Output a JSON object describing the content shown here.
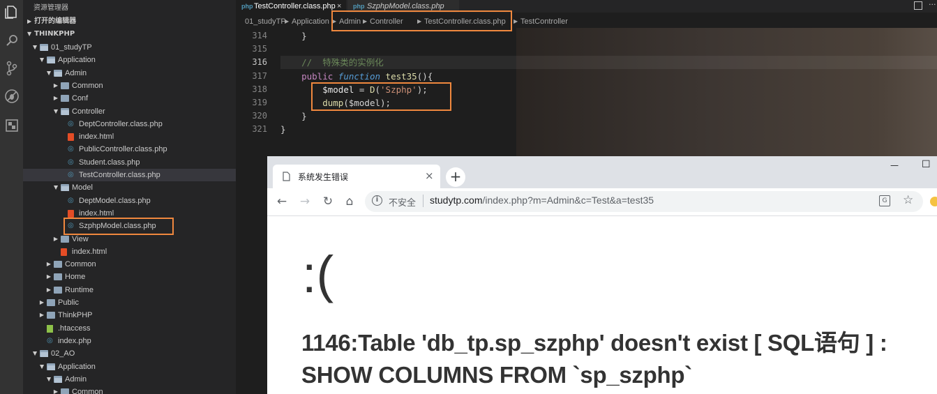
{
  "sidebar": {
    "title": "资源管理器",
    "open_editors": "打开的编辑器",
    "workspace": "THINKPHP",
    "tree": [
      {
        "label": "01_studyTP",
        "kind": "folder-open",
        "depth": 1
      },
      {
        "label": "Application",
        "kind": "folder-open",
        "depth": 2
      },
      {
        "label": "Admin",
        "kind": "folder-open",
        "depth": 3
      },
      {
        "label": "Common",
        "kind": "folder",
        "depth": 4
      },
      {
        "label": "Conf",
        "kind": "folder",
        "depth": 4
      },
      {
        "label": "Controller",
        "kind": "folder-open",
        "depth": 4
      },
      {
        "label": "DeptController.class.php",
        "kind": "php",
        "depth": 5
      },
      {
        "label": "index.html",
        "kind": "html",
        "depth": 5
      },
      {
        "label": "PublicController.class.php",
        "kind": "php",
        "depth": 5
      },
      {
        "label": "Student.class.php",
        "kind": "php",
        "depth": 5
      },
      {
        "label": "TestController.class.php",
        "kind": "php",
        "depth": 5
      },
      {
        "label": "Model",
        "kind": "folder-open",
        "depth": 4
      },
      {
        "label": "DeptModel.class.php",
        "kind": "php",
        "depth": 5
      },
      {
        "label": "index.html",
        "kind": "html",
        "depth": 5
      },
      {
        "label": "SzphpModel.class.php",
        "kind": "php",
        "depth": 5
      },
      {
        "label": "View",
        "kind": "folder",
        "depth": 4
      },
      {
        "label": "index.html",
        "kind": "html",
        "depth": 4
      },
      {
        "label": "Common",
        "kind": "folder",
        "depth": 3
      },
      {
        "label": "Home",
        "kind": "folder",
        "depth": 3
      },
      {
        "label": "Runtime",
        "kind": "folder",
        "depth": 3
      },
      {
        "label": "Public",
        "kind": "folder",
        "depth": 2
      },
      {
        "label": "ThinkPHP",
        "kind": "folder",
        "depth": 2
      },
      {
        "label": ".htaccess",
        "kind": "file",
        "depth": 2
      },
      {
        "label": "index.php",
        "kind": "php",
        "depth": 2
      },
      {
        "label": "02_AO",
        "kind": "folder-open",
        "depth": 1
      },
      {
        "label": "Application",
        "kind": "folder-open",
        "depth": 2
      },
      {
        "label": "Admin",
        "kind": "folder-open",
        "depth": 3
      },
      {
        "label": "Common",
        "kind": "folder",
        "depth": 4
      }
    ]
  },
  "editor": {
    "tabs": [
      {
        "label": "TestController.class.php",
        "close": "×"
      },
      {
        "label": "SzphpModel.class.php"
      }
    ],
    "breadcrumbs": [
      "01_studyTP",
      "Application",
      "Admin",
      "Controller",
      "TestController.class.php",
      "TestController"
    ],
    "lines": [
      {
        "num": "314",
        "text": "    }"
      },
      {
        "num": "315",
        "text": ""
      },
      {
        "num": "316",
        "text": "    //  特殊类的实例化"
      },
      {
        "num": "317",
        "text": "    public function test35(){"
      },
      {
        "num": "318",
        "text": "        $model = D('Szphp');"
      },
      {
        "num": "319",
        "text": "        dump($model);"
      },
      {
        "num": "320",
        "text": "    }"
      },
      {
        "num": "321",
        "text": "}"
      }
    ]
  },
  "browser": {
    "tab_title": "系统发生错误",
    "tab_close": "×",
    "new_tab": "+",
    "minimize": "—",
    "maximize": "☐",
    "security": "不安全",
    "url_host": "studytp.com",
    "url_path": "/index.php?m=Admin&c=Test&a=test35",
    "sad_face": ":(",
    "error_line1": "1146:Table 'db_tp.sp_szphp' doesn't exist [ SQL语句 ] :",
    "error_line2": "SHOW COLUMNS FROM `sp_szphp`"
  }
}
